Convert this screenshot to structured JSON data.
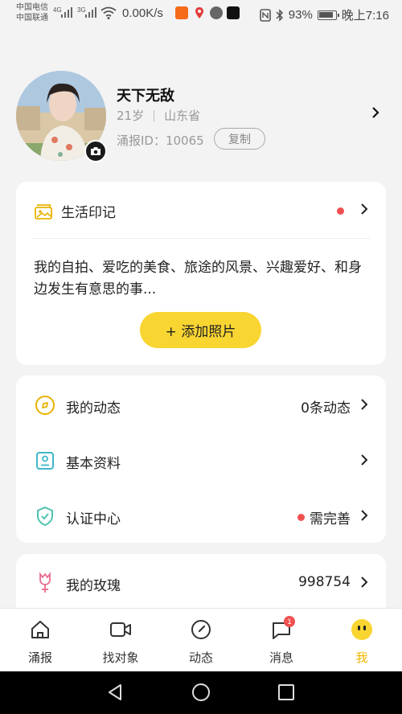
{
  "status_bar": {
    "carrier1": "中国电信",
    "carrier2": "中国联通",
    "net1": "4G",
    "net2": "3G",
    "speed": "0.00K/s",
    "battery": "93%",
    "time": "晚上7:16"
  },
  "profile": {
    "nickname": "天下无敌",
    "age": "21岁",
    "province": "山东省",
    "id_text": "涌报ID：10065",
    "copy_label": "复制"
  },
  "life_card": {
    "title": "生活印记",
    "description": "我的自拍、爱吃的美食、旅途的风景、兴趣爱好、和身边发生有意思的事...",
    "add_button": "+ 添加照片"
  },
  "menu": {
    "dynamics": {
      "label": "我的动态",
      "value": "0条动态"
    },
    "basic_info": {
      "label": "基本资料",
      "value": ""
    },
    "verify": {
      "label": "认证中心",
      "value": "需完善"
    },
    "roses": {
      "label": "我的玫瑰",
      "value": "998754"
    }
  },
  "tabs": [
    {
      "label": "涌报",
      "icon": "home-icon"
    },
    {
      "label": "找对象",
      "icon": "video-icon"
    },
    {
      "label": "动态",
      "icon": "compass-icon"
    },
    {
      "label": "消息",
      "icon": "message-icon",
      "badge": "1"
    },
    {
      "label": "我",
      "icon": "me-face-icon",
      "active": true
    }
  ],
  "colors": {
    "accent": "#f9d532",
    "active_tab": "#f2b500",
    "red_dot": "#f0504f",
    "background": "#f3f3f3"
  }
}
